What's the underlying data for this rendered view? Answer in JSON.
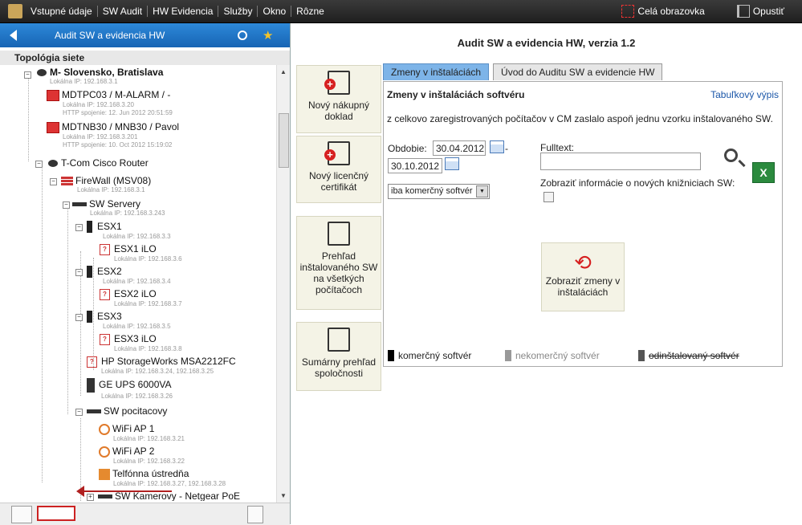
{
  "menubar": {
    "items": [
      "Vstupné údaje",
      "SW Audit",
      "HW Evidencia",
      "Služby",
      "Okno",
      "Rôzne"
    ],
    "fullscreen": "Celá obrazovka",
    "exit": "Opustiť"
  },
  "sidebar": {
    "header": "Audit SW a evidencia HW",
    "topology_title": "Topológia siete",
    "tree": [
      {
        "name": "M- Slovensko, Bratislava",
        "sub": "Lokálna IP: 192.168.3.1"
      },
      {
        "name": "MDTPC03 / M-ALARM / -",
        "sub": "Lokálna IP: 192.168.3.20",
        "sub2": "HTTP spojenie: 12. Jun 2012 20:51:59"
      },
      {
        "name": "MDTNB30 / MNB30 / Pavol",
        "sub": "Lokálna IP: 192.168.3.201",
        "sub2": "HTTP spojenie: 10. Oct 2012 15:19:02"
      },
      {
        "name": "T-Com Cisco Router"
      },
      {
        "name": "FireWall (MSV08)",
        "sub": "Lokálna IP: 192.168.3.1"
      },
      {
        "name": "SW Servery",
        "sub": "Lokálna IP: 192.168.3.243"
      },
      {
        "name": "ESX1",
        "sub": "Lokálna IP: 192.168.3.3"
      },
      {
        "name": "ESX1 iLO",
        "sub": "Lokálna IP: 192.168.3.6"
      },
      {
        "name": "ESX2",
        "sub": "Lokálna IP: 192.168.3.4"
      },
      {
        "name": "ESX2 iLO",
        "sub": "Lokálna IP: 192.168.3.7"
      },
      {
        "name": "ESX3",
        "sub": "Lokálna IP: 192.168.3.5"
      },
      {
        "name": "ESX3 iLO",
        "sub": "Lokálna IP: 192.168.3.8"
      },
      {
        "name": "HP StorageWorks MSA2212FC",
        "sub": "Lokálna IP: 192.168.3.24, 192.168.3.25"
      },
      {
        "name": "GE UPS 6000VA",
        "sub": "Lokálna IP: 192.168.3.26"
      },
      {
        "name": "SW pocitacovy"
      },
      {
        "name": "WiFi AP 1",
        "sub": "Lokálna IP: 192.168.3.21"
      },
      {
        "name": "WiFi AP 2",
        "sub": "Lokálna IP: 192.168.3.22"
      },
      {
        "name": "Telfónna ústredňa",
        "sub": "Lokálna IP: 192.168.3.27, 192.168.3.28"
      },
      {
        "name": "SW Kamerovy - Netgear PoE"
      }
    ]
  },
  "main": {
    "title": "Audit SW a evidencia HW, verzia 1.2",
    "actions": [
      {
        "label": "Nový nákupný doklad"
      },
      {
        "label": "Nový licenčný certifikát"
      },
      {
        "label": "Prehľad inštalovaného SW na všetkých počítačoch"
      },
      {
        "label": "Sumárny prehľad spoločnosti"
      }
    ],
    "tabs": [
      "Zmeny v inštaláciách",
      "Úvod do Auditu SW a evidencie HW"
    ],
    "panel": {
      "title": "Zmeny v inštaláciách softvéru",
      "table_link": "Tabuľkový výpis",
      "description": "z celkovo zaregistrovaných počítačov v CM zaslalo aspoň jednu vzorku inštalovaného SW.",
      "period_label": "Obdobie:",
      "date_from": "30.04.2012",
      "dash": "-",
      "date_to": "30.10.2012",
      "type_select": "iba komerčný softvér",
      "fulltext_label": "Fulltext:",
      "libs_label": "Zobraziť informácie o nových knižniciach SW:",
      "show_button": "Zobraziť zmeny v inštaláciách",
      "legend": [
        "komerčný softvér",
        "nekomerčný softvér",
        "odinštalovaný softvér"
      ]
    }
  },
  "colors": {
    "accent": "#1e74c8",
    "tab_active": "#7db4e8",
    "button_bg": "#f4f3e6",
    "red": "#d62020"
  }
}
